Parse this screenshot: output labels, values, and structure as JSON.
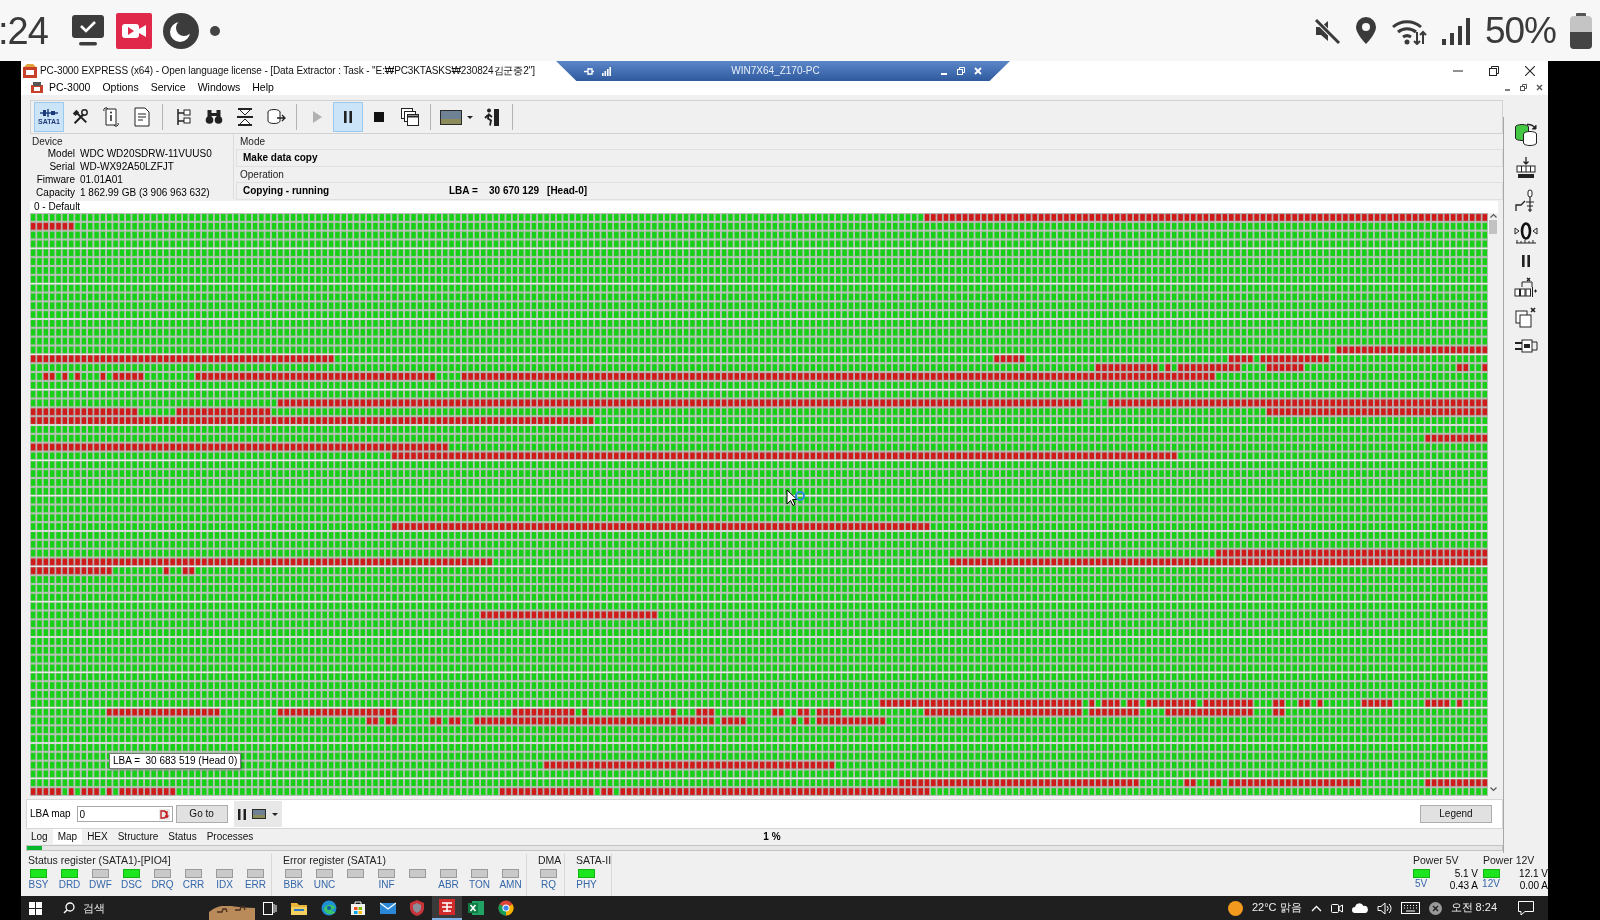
{
  "phone_status_bar": {
    "time": ":24",
    "battery": "50%"
  },
  "window": {
    "title": "PC-3000 EXPRESS (x64) - Open language license - [Data Extractor : Task - \"E:₩PC3KTASKS₩230824김군중2\"]"
  },
  "remote_session_bar": {
    "title": "WIN7X64_Z170-PC"
  },
  "menu": [
    "PC-3000",
    "Options",
    "Service",
    "Windows",
    "Help"
  ],
  "toolbar": [
    [
      {
        "label": "SATA1",
        "selected": true,
        "disabled": false
      },
      {
        "selected": false,
        "disabled": false
      },
      {
        "selected": false,
        "disabled": false
      },
      {
        "selected": false,
        "disabled": false
      }
    ],
    [
      {
        "selected": false,
        "disabled": false
      },
      {
        "selected": false,
        "disabled": false
      },
      {
        "selected": false,
        "disabled": false
      },
      {
        "selected": false,
        "disabled": false
      }
    ],
    [
      {
        "selected": false,
        "disabled": true
      },
      {
        "selected": true,
        "disabled": false
      },
      {
        "selected": false,
        "disabled": false
      },
      {
        "selected": false,
        "disabled": false
      }
    ],
    [
      {
        "selected": false,
        "disabled": false
      },
      {
        "selected": false,
        "disabled": false
      }
    ]
  ],
  "device": {
    "heading": "Device",
    "fields": [
      {
        "label": "Model",
        "value": "WDC WD20SDRW-11VUUS0"
      },
      {
        "label": "Serial",
        "value": "WD-WX92A50LZFJT"
      },
      {
        "label": "Fimware",
        "value": "01.01A01"
      },
      {
        "label": "Capacity",
        "value": "1 862.99 GB (3 906 963 632)"
      }
    ]
  },
  "mode": {
    "heading": "Mode",
    "value": "Make data copy"
  },
  "operation": {
    "heading": "Operation",
    "value": "Copying - running",
    "lba_label": "LBA =",
    "lba_value": "30 670 129",
    "head": "[Head-0]"
  },
  "map": {
    "title": "0 - Default",
    "tooltip": "LBA =  30 683 519 (Head 0)"
  },
  "lba_map": {
    "label": "LBA map",
    "value": "0",
    "go_button": "Go to",
    "legend_button": "Legend"
  },
  "tabs": [
    {
      "label": "Log",
      "selected": false
    },
    {
      "label": "Map",
      "selected": true
    },
    {
      "label": "HEX",
      "selected": false
    },
    {
      "label": "Structure",
      "selected": false
    },
    {
      "label": "Status",
      "selected": false
    },
    {
      "label": "Processes",
      "selected": false
    }
  ],
  "progress": {
    "text": "1 %",
    "level": 0.01
  },
  "registers": [
    {
      "title": "Status register (SATA1)-[PIO4]",
      "flags": [
        {
          "label": "BSY",
          "on": true
        },
        {
          "label": "DRD",
          "on": true
        },
        {
          "label": "DWF",
          "on": false
        },
        {
          "label": "DSC",
          "on": true
        },
        {
          "label": "DRQ",
          "on": false
        },
        {
          "label": "CRR",
          "on": false
        },
        {
          "label": "IDX",
          "on": false
        },
        {
          "label": "ERR",
          "on": false
        }
      ]
    },
    {
      "title": "Error register (SATA1)",
      "flags": [
        {
          "label": "BBK",
          "on": false
        },
        {
          "label": "UNC",
          "on": false
        },
        {
          "on": false
        },
        {
          "label": "INF",
          "on": false
        },
        {
          "on": false
        },
        {
          "label": "ABR",
          "on": false
        },
        {
          "label": "TON",
          "on": false
        },
        {
          "label": "AMN",
          "on": false
        }
      ]
    },
    {
      "title": "DMA",
      "flags": [
        {
          "label": "RQ",
          "on": false
        }
      ]
    },
    {
      "title": "SATA-II",
      "flags": [
        {
          "label": "PHY",
          "on": true
        }
      ]
    }
  ],
  "power": [
    {
      "title": "Power 5V",
      "label": "5V",
      "on": true,
      "voltage": "5.1 V",
      "current": "0.43 A"
    },
    {
      "title": "Power 12V",
      "label": "12V",
      "on": true,
      "voltage": "12.1 V",
      "current": "0.00 A"
    }
  ],
  "taskbar": {
    "search": {
      "placeholder": "검색"
    },
    "apps": [
      {
        "selected": false
      },
      {
        "selected": false
      },
      {
        "selected": false
      },
      {
        "selected": false
      },
      {
        "selected": false
      },
      {
        "selected": true
      },
      {
        "selected": false
      },
      {
        "selected": false
      }
    ],
    "weather": "22°C 맑음",
    "clock": "오전 8:24"
  }
}
